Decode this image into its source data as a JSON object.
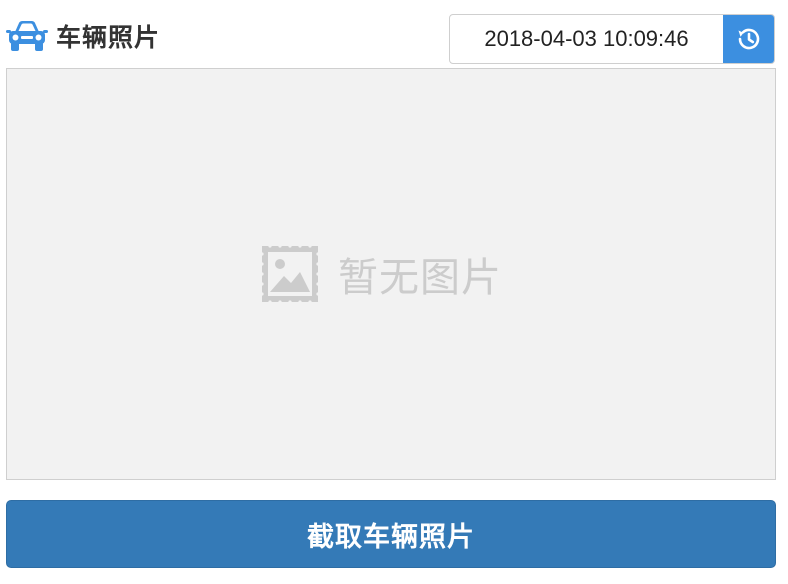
{
  "header": {
    "title": "车辆照片",
    "title_icon": "car-icon",
    "timestamp": "2018-04-03 10:09:46",
    "history_icon": "clock-history-icon"
  },
  "photo": {
    "placeholder_text": "暂无图片",
    "placeholder_icon": "image-placeholder-icon"
  },
  "actions": {
    "capture_label": "截取车辆照片"
  },
  "colors": {
    "accent": "#3c8fe0",
    "button": "#347ab7",
    "placeholder_bg": "#f2f2f2",
    "placeholder_fg": "#cccccc"
  }
}
